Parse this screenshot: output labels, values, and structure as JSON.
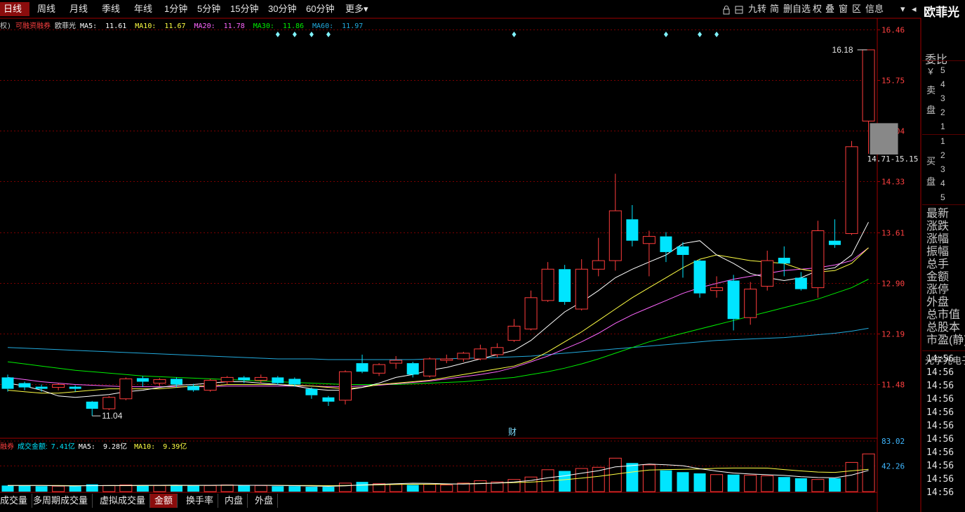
{
  "period_tabs": [
    "日线",
    "周线",
    "月线",
    "季线",
    "年线",
    "1分钟",
    "5分钟",
    "15分钟",
    "30分钟",
    "60分钟"
  ],
  "more_label": "更多▾",
  "active_period": "日线",
  "right_tools": [
    "九转",
    "简",
    "删自选",
    "权",
    "叠",
    "窗",
    "区",
    "信息"
  ],
  "stock_name": "欧菲光",
  "info": {
    "prefix": "权)",
    "margin_tag": "可融资融券",
    "name": "欧菲光",
    "ma5_label": "MA5:",
    "ma5": "11.61",
    "ma10_label": "MA10:",
    "ma10": "11.67",
    "ma20_label": "MA20:",
    "ma20": "11.78",
    "ma30_label": "MA30:",
    "ma30": "11.86",
    "ma60_label": "MA60:",
    "ma60": "11.97"
  },
  "price_axis": [
    "16.46",
    "15.75",
    "15.04",
    "14.33",
    "13.61",
    "12.90",
    "12.19",
    "11.48"
  ],
  "annotations": {
    "high": "16.18",
    "low": "11.04",
    "range": "14.71-15.15",
    "fin_marker": "财"
  },
  "vol_info": {
    "prefix": "融券",
    "label": "成交金额:",
    "value": "7.41亿",
    "ma5_label": "MA5:",
    "ma5": "9.28亿",
    "ma10_label": "MA10:",
    "ma10": "9.39亿"
  },
  "vol_axis": [
    "83.02",
    "42.26"
  ],
  "bottom_tabs": [
    "成交量",
    "多周期成交量",
    "虚拟成交量",
    "金额",
    "换手率",
    "内盘",
    "外盘"
  ],
  "active_bottom_tab": "金额",
  "side_panel": {
    "wei_bi": "委比",
    "yen": "￥",
    "sell_label": [
      "卖",
      "盘"
    ],
    "buy_label": [
      "买",
      "盘"
    ],
    "sell_levels": [
      "5",
      "4",
      "3",
      "2",
      "1"
    ],
    "buy_levels": [
      "1",
      "2",
      "3",
      "4",
      "5"
    ],
    "fields": [
      "最新",
      "涨跌",
      "涨幅",
      "振幅",
      "总手",
      "金额",
      "涨停",
      "外盘",
      "总市值",
      "总股本",
      "市盈(静)"
    ],
    "industry": "光学光电子",
    "times": [
      "14:56",
      "14:56",
      "14:56",
      "14:56",
      "14:56",
      "14:56",
      "14:56",
      "14:56",
      "14:56",
      "14:56",
      "14:56"
    ]
  },
  "colors": {
    "up": "#ff3c3c",
    "down": "#00e5ff",
    "ma5": "#ffffff",
    "ma10": "#ffff44",
    "ma20": "#ff66ff",
    "ma30": "#00ee00",
    "ma60": "#22aadd",
    "grid": "#7a0000",
    "axis_text": "#ff4040"
  },
  "chart_data": {
    "type": "candlestick",
    "ylim": [
      10.9,
      16.6
    ],
    "candles": [
      {
        "o": 11.58,
        "c": 11.42,
        "h": 11.62,
        "l": 11.38
      },
      {
        "o": 11.5,
        "c": 11.44,
        "h": 11.52,
        "l": 11.4
      },
      {
        "o": 11.45,
        "c": 11.42,
        "h": 11.48,
        "l": 11.38
      },
      {
        "o": 11.44,
        "c": 11.48,
        "h": 11.5,
        "l": 11.4
      },
      {
        "o": 11.45,
        "c": 11.42,
        "h": 11.47,
        "l": 11.38
      },
      {
        "o": 11.24,
        "c": 11.14,
        "h": 11.25,
        "l": 11.04
      },
      {
        "o": 11.14,
        "c": 11.3,
        "h": 11.32,
        "l": 11.12
      },
      {
        "o": 11.28,
        "c": 11.56,
        "h": 11.58,
        "l": 11.26
      },
      {
        "o": 11.57,
        "c": 11.52,
        "h": 11.6,
        "l": 11.45
      },
      {
        "o": 11.5,
        "c": 11.55,
        "h": 11.57,
        "l": 11.46
      },
      {
        "o": 11.56,
        "c": 11.48,
        "h": 11.58,
        "l": 11.44
      },
      {
        "o": 11.46,
        "c": 11.4,
        "h": 11.49,
        "l": 11.38
      },
      {
        "o": 11.4,
        "c": 11.54,
        "h": 11.56,
        "l": 11.38
      },
      {
        "o": 11.52,
        "c": 11.58,
        "h": 11.6,
        "l": 11.48
      },
      {
        "o": 11.58,
        "c": 11.54,
        "h": 11.6,
        "l": 11.5
      },
      {
        "o": 11.54,
        "c": 11.58,
        "h": 11.62,
        "l": 11.5
      },
      {
        "o": 11.58,
        "c": 11.5,
        "h": 11.6,
        "l": 11.48
      },
      {
        "o": 11.56,
        "c": 11.48,
        "h": 11.58,
        "l": 11.45
      },
      {
        "o": 11.42,
        "c": 11.33,
        "h": 11.44,
        "l": 11.28
      },
      {
        "o": 11.3,
        "c": 11.24,
        "h": 11.32,
        "l": 11.18
      },
      {
        "o": 11.26,
        "c": 11.66,
        "h": 11.68,
        "l": 11.2
      },
      {
        "o": 11.78,
        "c": 11.66,
        "h": 11.9,
        "l": 11.64
      },
      {
        "o": 11.64,
        "c": 11.76,
        "h": 11.78,
        "l": 11.6
      },
      {
        "o": 11.78,
        "c": 11.82,
        "h": 11.88,
        "l": 11.7
      },
      {
        "o": 11.78,
        "c": 11.62,
        "h": 11.8,
        "l": 11.58
      },
      {
        "o": 11.6,
        "c": 11.84,
        "h": 11.86,
        "l": 11.58
      },
      {
        "o": 11.82,
        "c": 11.84,
        "h": 11.9,
        "l": 11.78
      },
      {
        "o": 11.84,
        "c": 11.92,
        "h": 11.94,
        "l": 11.8
      },
      {
        "o": 11.84,
        "c": 11.98,
        "h": 12.04,
        "l": 11.82
      },
      {
        "o": 11.9,
        "c": 12.0,
        "h": 12.06,
        "l": 11.86
      },
      {
        "o": 12.1,
        "c": 12.3,
        "h": 12.4,
        "l": 12.08
      },
      {
        "o": 12.26,
        "c": 12.7,
        "h": 12.8,
        "l": 12.24
      },
      {
        "o": 12.66,
        "c": 13.1,
        "h": 13.2,
        "l": 12.64
      },
      {
        "o": 13.1,
        "c": 12.64,
        "h": 13.16,
        "l": 12.6
      },
      {
        "o": 12.54,
        "c": 13.1,
        "h": 13.24,
        "l": 12.52
      },
      {
        "o": 13.1,
        "c": 13.22,
        "h": 13.54,
        "l": 13.0
      },
      {
        "o": 13.22,
        "c": 13.92,
        "h": 14.44,
        "l": 13.08
      },
      {
        "o": 13.8,
        "c": 13.5,
        "h": 14.0,
        "l": 13.42
      },
      {
        "o": 13.46,
        "c": 13.56,
        "h": 13.64,
        "l": 13.0
      },
      {
        "o": 13.56,
        "c": 13.34,
        "h": 13.62,
        "l": 13.2
      },
      {
        "o": 13.42,
        "c": 13.3,
        "h": 13.48,
        "l": 12.98
      },
      {
        "o": 13.22,
        "c": 12.76,
        "h": 13.24,
        "l": 12.7
      },
      {
        "o": 12.8,
        "c": 12.84,
        "h": 13.0,
        "l": 12.7
      },
      {
        "o": 12.94,
        "c": 12.4,
        "h": 13.02,
        "l": 12.24
      },
      {
        "o": 12.42,
        "c": 12.82,
        "h": 12.92,
        "l": 12.32
      },
      {
        "o": 12.86,
        "c": 13.22,
        "h": 13.36,
        "l": 12.8
      },
      {
        "o": 13.26,
        "c": 13.18,
        "h": 13.42,
        "l": 13.0
      },
      {
        "o": 12.98,
        "c": 12.82,
        "h": 13.06,
        "l": 12.8
      },
      {
        "o": 12.84,
        "c": 13.64,
        "h": 13.78,
        "l": 12.7
      },
      {
        "o": 13.5,
        "c": 13.44,
        "h": 13.8,
        "l": 13.4
      },
      {
        "o": 13.6,
        "c": 14.82,
        "h": 14.9,
        "l": 13.58
      },
      {
        "o": 15.18,
        "c": 16.18,
        "h": 16.18,
        "l": 14.72
      }
    ],
    "ma5": [
      11.5,
      11.46,
      11.4,
      11.32,
      11.3,
      11.32,
      11.34,
      11.38,
      11.4,
      11.44,
      11.47,
      11.48,
      11.5,
      11.52,
      11.52,
      11.5,
      11.48,
      11.46,
      11.42,
      11.4,
      11.4,
      11.44,
      11.5,
      11.58,
      11.62,
      11.68,
      11.72,
      11.78,
      11.84,
      11.9,
      11.96,
      12.1,
      12.3,
      12.5,
      12.64,
      12.8,
      12.98,
      13.1,
      13.2,
      13.3,
      13.46,
      13.5,
      13.3,
      13.18,
      13.04,
      12.98,
      12.94,
      12.98,
      13.08,
      13.12,
      13.3,
      13.76
    ],
    "ma10": [
      11.4,
      11.38,
      11.36,
      11.36,
      11.38,
      11.4,
      11.42,
      11.42,
      11.42,
      11.42,
      11.44,
      11.46,
      11.46,
      11.48,
      11.48,
      11.48,
      11.48,
      11.47,
      11.46,
      11.44,
      11.42,
      11.44,
      11.48,
      11.5,
      11.52,
      11.54,
      11.58,
      11.62,
      11.66,
      11.7,
      11.74,
      11.82,
      11.94,
      12.08,
      12.22,
      12.38,
      12.54,
      12.7,
      12.84,
      12.98,
      13.12,
      13.24,
      13.3,
      13.26,
      13.22,
      13.2,
      13.18,
      13.1,
      13.06,
      13.08,
      13.18,
      13.4
    ],
    "ma20": [
      11.58,
      11.55,
      11.52,
      11.5,
      11.48,
      11.47,
      11.46,
      11.45,
      11.45,
      11.45,
      11.45,
      11.45,
      11.45,
      11.46,
      11.46,
      11.46,
      11.46,
      11.46,
      11.46,
      11.45,
      11.45,
      11.46,
      11.47,
      11.49,
      11.51,
      11.53,
      11.56,
      11.59,
      11.62,
      11.66,
      11.72,
      11.8,
      11.88,
      11.98,
      12.08,
      12.2,
      12.34,
      12.46,
      12.56,
      12.66,
      12.76,
      12.84,
      12.9,
      12.96,
      13.0,
      13.04,
      13.08,
      13.1,
      13.12,
      13.16,
      13.22,
      13.4
    ],
    "ma30": [
      11.8,
      11.77,
      11.74,
      11.71,
      11.68,
      11.66,
      11.64,
      11.62,
      11.6,
      11.59,
      11.58,
      11.57,
      11.56,
      11.55,
      11.54,
      11.53,
      11.52,
      11.51,
      11.5,
      11.49,
      11.48,
      11.48,
      11.48,
      11.48,
      11.49,
      11.5,
      11.51,
      11.52,
      11.54,
      11.56,
      11.58,
      11.62,
      11.66,
      11.71,
      11.77,
      11.84,
      11.92,
      12.0,
      12.08,
      12.14,
      12.2,
      12.26,
      12.32,
      12.38,
      12.44,
      12.5,
      12.56,
      12.62,
      12.68,
      12.76,
      12.84,
      12.96
    ],
    "ma60": [
      12.0,
      11.99,
      11.98,
      11.97,
      11.96,
      11.95,
      11.94,
      11.93,
      11.92,
      11.91,
      11.9,
      11.89,
      11.88,
      11.87,
      11.86,
      11.85,
      11.84,
      11.84,
      11.84,
      11.83,
      11.83,
      11.83,
      11.83,
      11.83,
      11.83,
      11.84,
      11.84,
      11.85,
      11.85,
      11.86,
      11.87,
      11.88,
      11.9,
      11.92,
      11.94,
      11.96,
      11.98,
      12.0,
      12.02,
      12.04,
      12.06,
      12.08,
      12.1,
      12.11,
      12.12,
      12.13,
      12.14,
      12.16,
      12.18,
      12.2,
      12.23,
      12.27
    ],
    "volume": [
      10,
      10,
      9,
      9,
      9,
      12,
      10,
      11,
      10,
      10,
      11,
      10,
      10,
      11,
      10,
      10,
      9,
      9,
      8,
      8,
      14,
      16,
      13,
      12,
      11,
      12,
      11,
      14,
      18,
      16,
      20,
      24,
      36,
      34,
      38,
      40,
      55,
      47,
      44,
      35,
      32,
      30,
      28,
      28,
      27,
      26,
      24,
      22,
      20,
      22,
      48,
      62
    ],
    "vol_ma5": [
      10,
      10,
      10,
      9.6,
      9.4,
      9.8,
      10,
      10.2,
      10.4,
      10.4,
      10.6,
      10.4,
      10.4,
      10.6,
      10.4,
      10.4,
      10,
      9.8,
      9.2,
      8.8,
      9.6,
      11,
      12,
      13,
      13.8,
      13.6,
      12.8,
      12.4,
      13.2,
      14.2,
      15.8,
      18.4,
      22.8,
      26,
      30.4,
      34.4,
      40.6,
      42.8,
      45.2,
      44.2,
      42.6,
      37.6,
      33.8,
      30.6,
      29,
      27.8,
      26.6,
      24.6,
      23.2,
      22.8,
      27.2,
      34.8
    ],
    "vol_ma10": [
      10,
      10,
      10,
      10,
      9.8,
      9.8,
      9.8,
      9.8,
      9.9,
      10,
      10.1,
      10.2,
      10.3,
      10.4,
      10.4,
      10.4,
      10.3,
      10.2,
      10,
      9.8,
      10.1,
      10.7,
      11.2,
      11.8,
      12.1,
      12.2,
      12.2,
      12.8,
      13.6,
      14.2,
      14.9,
      15.7,
      17.4,
      19.6,
      22.2,
      25,
      28.7,
      32.3,
      35.5,
      36.2,
      36.6,
      37.2,
      38.3,
      38.8,
      38.8,
      38.7,
      36.2,
      34,
      32.2,
      31.6,
      34.1,
      36.7
    ],
    "volume_ylim": [
      0,
      90
    ],
    "signal_markers": [
      16,
      17,
      18,
      19,
      30,
      39,
      41,
      42
    ]
  }
}
